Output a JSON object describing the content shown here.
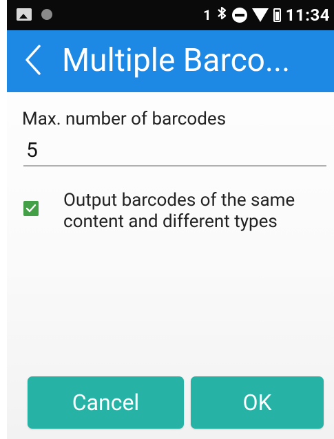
{
  "status_bar": {
    "sim_label": "1",
    "time": "11:34",
    "icons": [
      "image-notification-icon",
      "circle-notification-icon",
      "bluetooth-icon",
      "do-not-disturb-icon",
      "wifi-icon",
      "battery-icon"
    ]
  },
  "app_bar": {
    "title": "Multiple Barco...",
    "back_icon": "chevron-left-icon",
    "color": "#1e88e5"
  },
  "max_barcodes": {
    "label": "Max. number of barcodes",
    "value": "5"
  },
  "output_option": {
    "label": "Output barcodes of the same content and different types",
    "checked": true,
    "check_color": "#43a047"
  },
  "buttons": {
    "cancel_label": "Cancel",
    "ok_label": "OK",
    "color": "#26b3a6"
  }
}
